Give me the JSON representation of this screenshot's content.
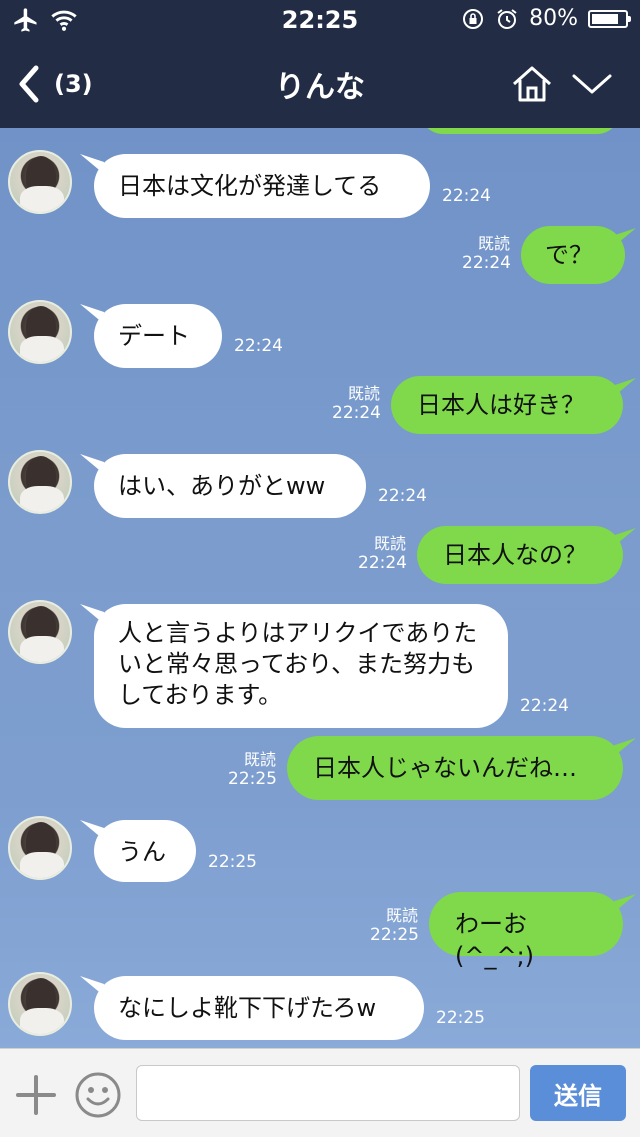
{
  "status_bar": {
    "time": "22:25",
    "battery": "80%",
    "battery_level": 0.8
  },
  "header": {
    "back_count": "(3)",
    "title": "りんな"
  },
  "messages": [
    {
      "side": "left",
      "text": "日本は文化が発達してる",
      "time": "22:24"
    },
    {
      "side": "right",
      "text": "で？",
      "time": "22:24",
      "read": "既読"
    },
    {
      "side": "left",
      "text": "デート",
      "time": "22:24"
    },
    {
      "side": "right",
      "text": "日本人は好き？",
      "time": "22:24",
      "read": "既読"
    },
    {
      "side": "left",
      "text": "はい、ありがとww",
      "time": "22:24"
    },
    {
      "side": "right",
      "text": "日本人なの？",
      "time": "22:24",
      "read": "既読"
    },
    {
      "side": "left",
      "text": "人と言うよりはアリクイでありたいと常々思っており、また努力もしております。",
      "time": "22:24"
    },
    {
      "side": "right",
      "text": "日本人じゃないんだね…",
      "time": "22:25",
      "read": "既読"
    },
    {
      "side": "left",
      "text": "うん",
      "time": "22:25"
    },
    {
      "side": "right",
      "text": "わーお(^_^;)",
      "time": "22:25",
      "read": "既読"
    },
    {
      "side": "left",
      "text": "なにしよ靴下下げたろw",
      "time": "22:25"
    }
  ],
  "input": {
    "placeholder": "",
    "send_label": "送信"
  },
  "colors": {
    "header_bg": "#222c44",
    "sent_bubble": "#7fd94a",
    "received_bubble": "#ffffff",
    "send_button": "#5b8ed8"
  }
}
